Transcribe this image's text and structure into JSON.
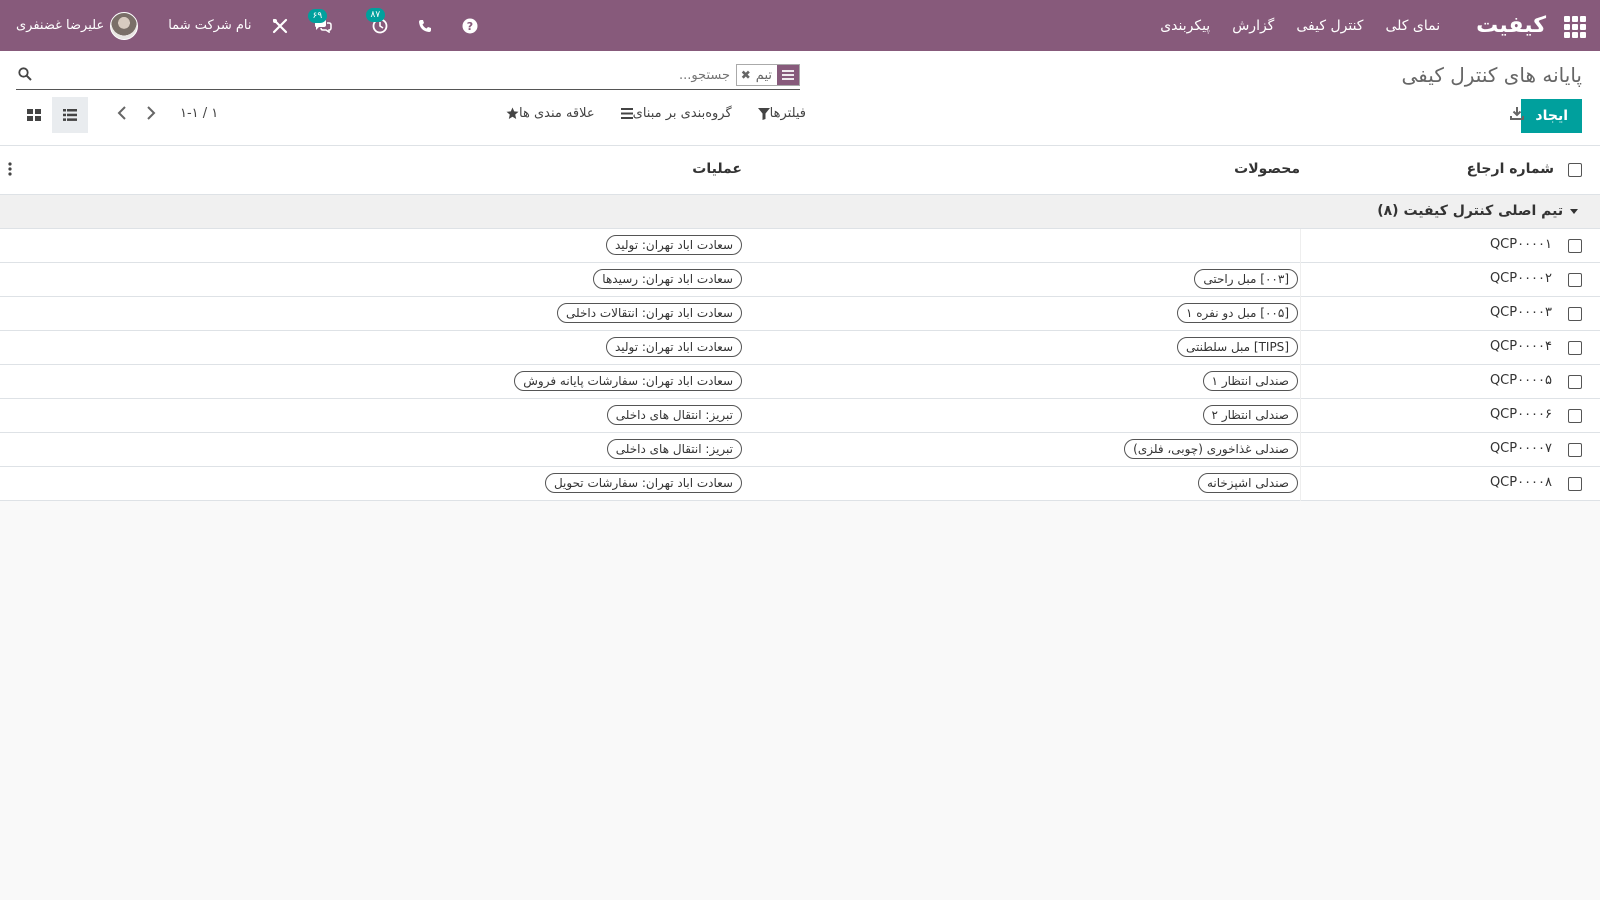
{
  "navbar": {
    "brand": "کیفیت",
    "menu": [
      "نمای کلی",
      "کنترل کیفی",
      "گزارش",
      "پیکربندی"
    ],
    "user_name": "علیرضا غضنفری",
    "company": "نام شرکت شما",
    "activity_count": "۸۷",
    "messages_count": "۶۹"
  },
  "control": {
    "title": "پایانه های کنترل کیفی",
    "search_placeholder": "جستجو...",
    "facet_value": "تیم",
    "create_label": "ایجاد",
    "filters_label": "فیلترها",
    "groupby_label": "گروه‌بندی بر مبنای",
    "favorites_label": "علاقه مندی ها",
    "pager": "۱-۱ / ۱"
  },
  "table": {
    "headers": {
      "reference": "شماره ارجاع",
      "products": "محصولات",
      "operations": "عملیات"
    },
    "group": "تیم اصلی کنترل کیفیت (۸)",
    "rows": [
      {
        "ref": "QCP۰۰۰۰۱",
        "product": "",
        "operation": "سعادت اباد تهران: تولید"
      },
      {
        "ref": "QCP۰۰۰۰۲",
        "product": "[۰۰۳] مبل راحتی",
        "operation": "سعادت اباد تهران: رسیدها"
      },
      {
        "ref": "QCP۰۰۰۰۳",
        "product": "[۰۰۵] مبل دو نفره ۱",
        "operation": "سعادت اباد تهران: انتقالات داخلی"
      },
      {
        "ref": "QCP۰۰۰۰۴",
        "product": "[TIPS] مبل سلطنتی",
        "operation": "سعادت اباد تهران: تولید"
      },
      {
        "ref": "QCP۰۰۰۰۵",
        "product": "صندلی انتظار ۱",
        "operation": "سعادت اباد تهران: سفارشات پایانه فروش"
      },
      {
        "ref": "QCP۰۰۰۰۶",
        "product": "صندلی انتظار ۲",
        "operation": "تبریز: انتقال های داخلی"
      },
      {
        "ref": "QCP۰۰۰۰۷",
        "product": "صندلی غذاخوری (چوبی، فلزی)",
        "operation": "تبریز: انتقال های داخلی"
      },
      {
        "ref": "QCP۰۰۰۰۸",
        "product": "صندلی اشپزخانه",
        "operation": "سعادت اباد تهران: سفارشات تحویل"
      }
    ]
  },
  "colors": {
    "brand": "#875a7b",
    "primary": "#00a09d"
  },
  "icons": [
    "apps-grid-icon",
    "help-icon",
    "phone-icon",
    "clock-icon",
    "chat-icon",
    "tools-icon",
    "search-icon",
    "download-icon",
    "filter-icon",
    "list-icon",
    "star-icon",
    "chevron-left-icon",
    "chevron-right-icon",
    "kanban-view-icon",
    "list-view-icon",
    "caret-down-icon",
    "column-options-icon"
  ]
}
